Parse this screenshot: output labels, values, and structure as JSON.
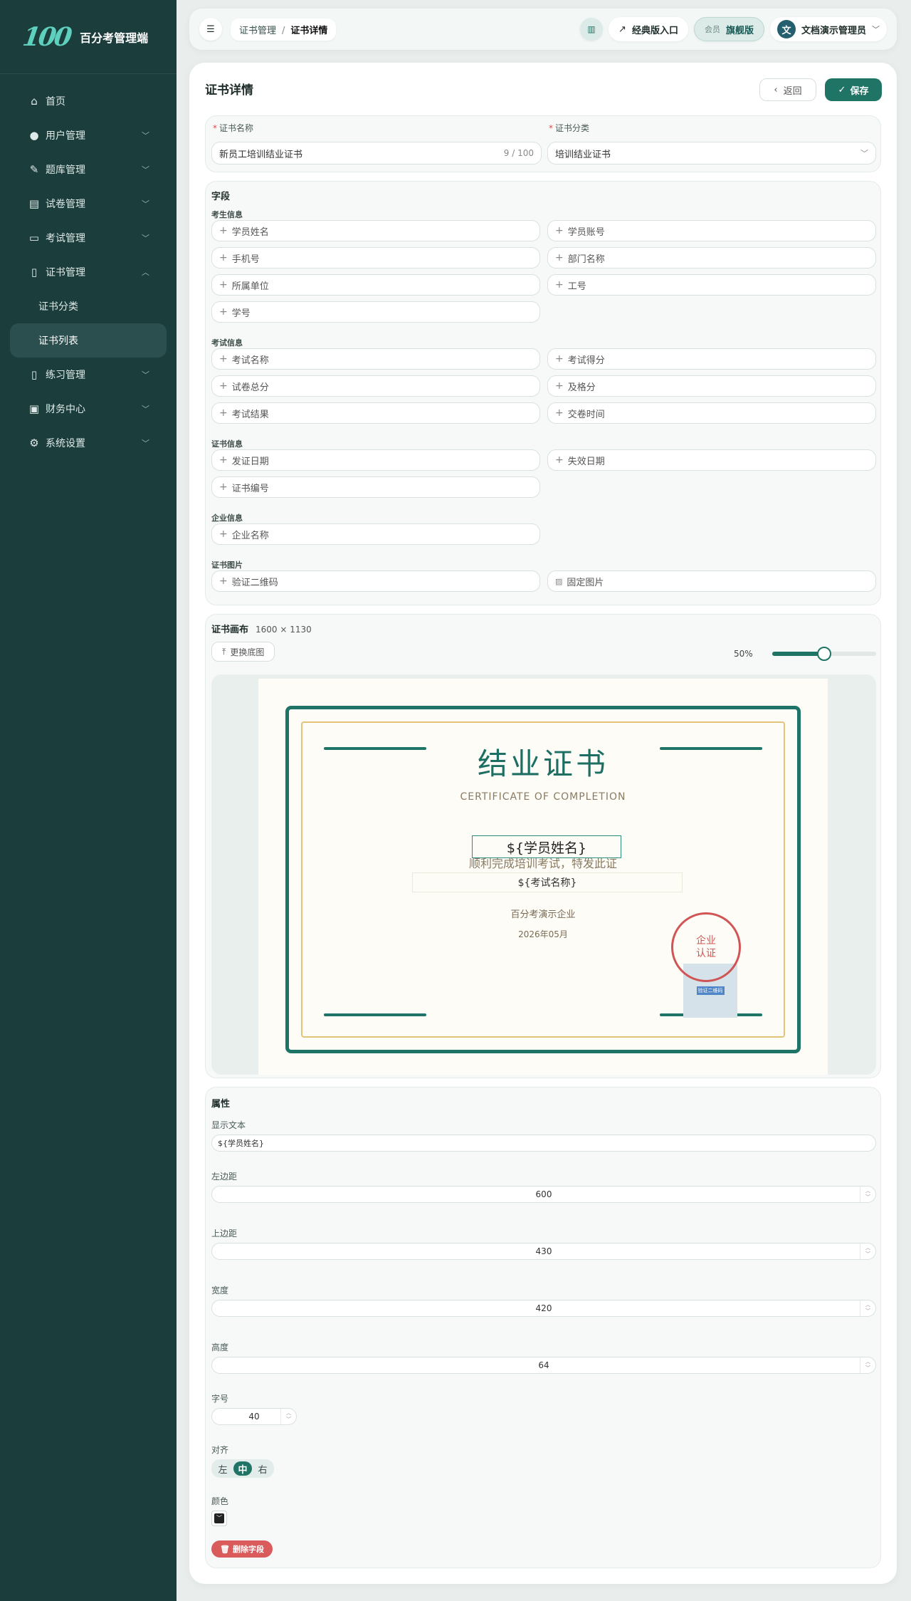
{
  "app": {
    "logo_mark": "100",
    "name": "百分考管理端"
  },
  "sidebar": {
    "items": [
      {
        "label": "首页",
        "icon": "home-icon",
        "glyph": "⌂"
      },
      {
        "label": "用户管理",
        "icon": "user-icon",
        "glyph": "●"
      },
      {
        "label": "题库管理",
        "icon": "pen-icon",
        "glyph": "✎"
      },
      {
        "label": "试卷管理",
        "icon": "layers-icon",
        "glyph": "▤"
      },
      {
        "label": "考试管理",
        "icon": "presentation-icon",
        "glyph": "▭"
      },
      {
        "label": "证书管理",
        "icon": "document-icon",
        "glyph": "▯"
      },
      {
        "label": "证书分类"
      },
      {
        "label": "证书列表"
      },
      {
        "label": "练习管理",
        "icon": "document-icon",
        "glyph": "▯"
      },
      {
        "label": "财务中心",
        "icon": "wallet-icon",
        "glyph": "▣"
      },
      {
        "label": "系统设置",
        "icon": "gear-icon",
        "glyph": "⚙"
      }
    ]
  },
  "topbar": {
    "breadcrumb": [
      "证书管理",
      "证书详情"
    ],
    "classic_link": "经典版入口",
    "member_label": "会员",
    "edition": "旗舰版",
    "avatar_initial": "文",
    "user_name": "文档演示管理员"
  },
  "page": {
    "title": "证书详情",
    "back_label": "返回",
    "save_label": "保存"
  },
  "form": {
    "name_label": "证书名称",
    "name_value": "新员工培训结业证书",
    "name_count": "9 / 100",
    "category_label": "证书分类",
    "category_value": "培训结业证书"
  },
  "fields": {
    "title": "字段",
    "groups": [
      {
        "title": "考生信息",
        "items": [
          "学员姓名",
          "学员账号",
          "手机号",
          "部门名称",
          "所属单位",
          "工号",
          "学号"
        ]
      },
      {
        "title": "考试信息",
        "items": [
          "考试名称",
          "考试得分",
          "试卷总分",
          "及格分",
          "考试结果",
          "交卷时间"
        ]
      },
      {
        "title": "证书信息",
        "items": [
          "发证日期",
          "失效日期",
          "证书编号"
        ]
      },
      {
        "title": "企业信息",
        "items": [
          "企业名称"
        ]
      },
      {
        "title": "证书图片",
        "items": [
          "验证二维码",
          "固定图片"
        ]
      }
    ]
  },
  "canvas": {
    "title": "证书画布",
    "size": "1600 × 1130",
    "replace_label": "更换底图",
    "zoom_label": "50%",
    "zoom_value": 0.5
  },
  "certificate": {
    "title": "结业证书",
    "subtitle": "CERTIFICATE OF COMPLETION",
    "name_placeholder": "${学员姓名}",
    "body_text": "顺利完成培训考试，特发此证",
    "exam_placeholder": "${考试名称}",
    "company": "百分考演示企业",
    "date": "2026年05月",
    "seal_line1": "企业",
    "seal_line2": "认证",
    "qr_label": "验证二维码"
  },
  "props": {
    "title": "属性",
    "text_label": "显示文本",
    "text_value": "${学员姓名}",
    "left_label": "左边距",
    "left_value": "600",
    "top_label": "上边距",
    "top_value": "430",
    "width_label": "宽度",
    "width_value": "420",
    "height_label": "高度",
    "height_value": "64",
    "size_label": "字号",
    "size_value": "40",
    "align_label": "对齐",
    "align_options": [
      "左",
      "中",
      "右"
    ],
    "color_label": "颜色",
    "color_value": "#222222",
    "delete_label": "删除字段"
  },
  "colors": {
    "primary": "#1f7466",
    "sidebar": "#1b3d3c",
    "danger": "#d95b5b",
    "seal": "#d05656"
  }
}
